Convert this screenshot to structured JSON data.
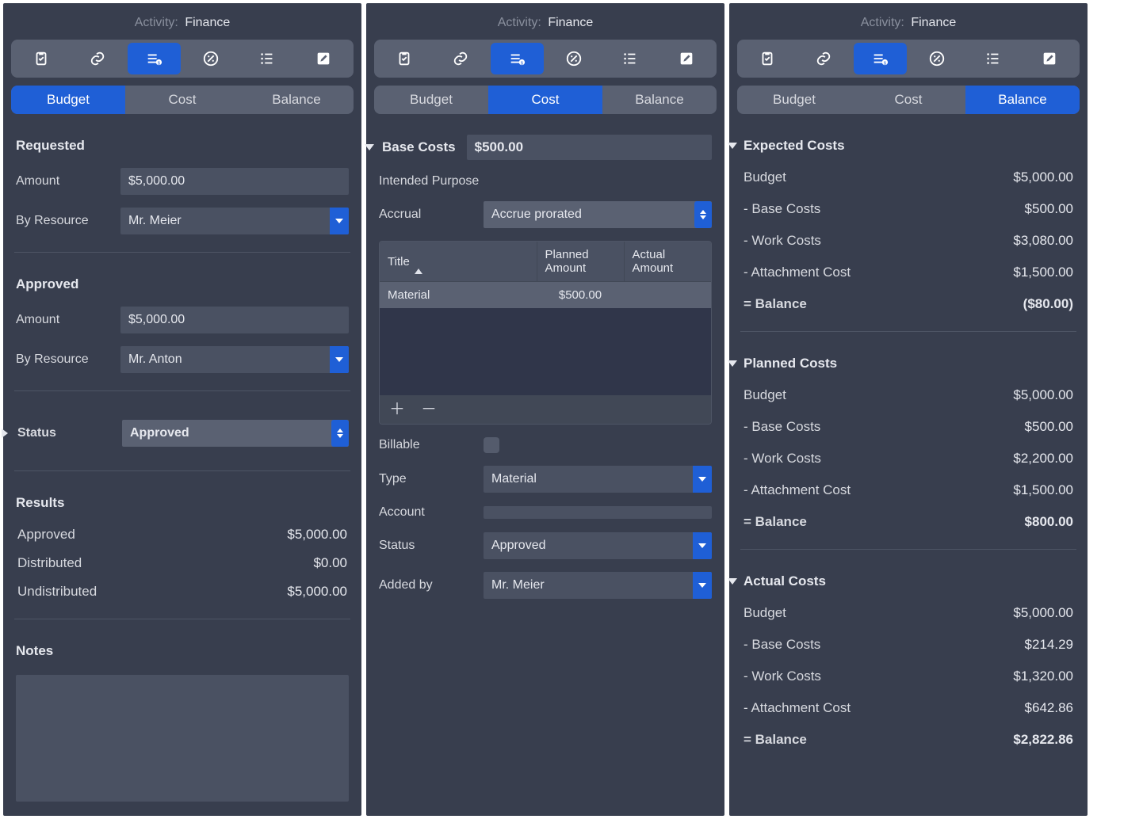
{
  "header": {
    "activity_label": "Activity:",
    "activity_value": "Finance"
  },
  "toolbar_icons": [
    "clipboard-icon",
    "link-icon",
    "finance-icon",
    "percent-icon",
    "list-icon",
    "pencil-icon"
  ],
  "subtabs": {
    "budget": "Budget",
    "cost": "Cost",
    "balance": "Balance"
  },
  "panel1": {
    "requested_h": "Requested",
    "amount_l": "Amount",
    "req_amount": "$5,000.00",
    "byres_l": "By Resource",
    "req_byres": "Mr. Meier",
    "approved_h": "Approved",
    "app_amount": "$5,000.00",
    "app_byres": "Mr. Anton",
    "status_l": "Status",
    "status_v": "Approved",
    "results_h": "Results",
    "results": [
      {
        "k": "Approved",
        "v": "$5,000.00"
      },
      {
        "k": "Distributed",
        "v": "$0.00"
      },
      {
        "k": "Undistributed",
        "v": "$5,000.00"
      }
    ],
    "notes_h": "Notes"
  },
  "panel2": {
    "basecosts_h": "Base Costs",
    "basecosts_v": "$500.00",
    "intended_l": "Intended Purpose",
    "accrual_l": "Accrual",
    "accrual_v": "Accrue prorated",
    "th_title": "Title",
    "th_planned": "Planned Amount",
    "th_actual": "Actual Amount",
    "row_title": "Material",
    "row_planned": "$500.00",
    "billable_l": "Billable",
    "type_l": "Type",
    "type_v": "Material",
    "account_l": "Account",
    "status_l": "Status",
    "status_v": "Approved",
    "addedby_l": "Added by",
    "addedby_v": "Mr. Meier"
  },
  "panel3": {
    "sections": [
      {
        "h": "Expected Costs",
        "rows": [
          {
            "k": "Budget",
            "v": "$5,000.00"
          },
          {
            "k": "- Base Costs",
            "v": "$500.00"
          },
          {
            "k": "- Work Costs",
            "v": "$3,080.00"
          },
          {
            "k": "- Attachment Cost",
            "v": "$1,500.00"
          },
          {
            "k": "= Balance",
            "v": "($80.00)"
          }
        ]
      },
      {
        "h": "Planned Costs",
        "rows": [
          {
            "k": "Budget",
            "v": "$5,000.00"
          },
          {
            "k": "- Base Costs",
            "v": "$500.00"
          },
          {
            "k": "- Work Costs",
            "v": "$2,200.00"
          },
          {
            "k": "- Attachment Cost",
            "v": "$1,500.00"
          },
          {
            "k": "= Balance",
            "v": "$800.00"
          }
        ]
      },
      {
        "h": "Actual Costs",
        "rows": [
          {
            "k": "Budget",
            "v": "$5,000.00"
          },
          {
            "k": "- Base Costs",
            "v": "$214.29"
          },
          {
            "k": "- Work Costs",
            "v": "$1,320.00"
          },
          {
            "k": "- Attachment Cost",
            "v": "$642.86"
          },
          {
            "k": "= Balance",
            "v": "$2,822.86"
          }
        ]
      }
    ]
  }
}
